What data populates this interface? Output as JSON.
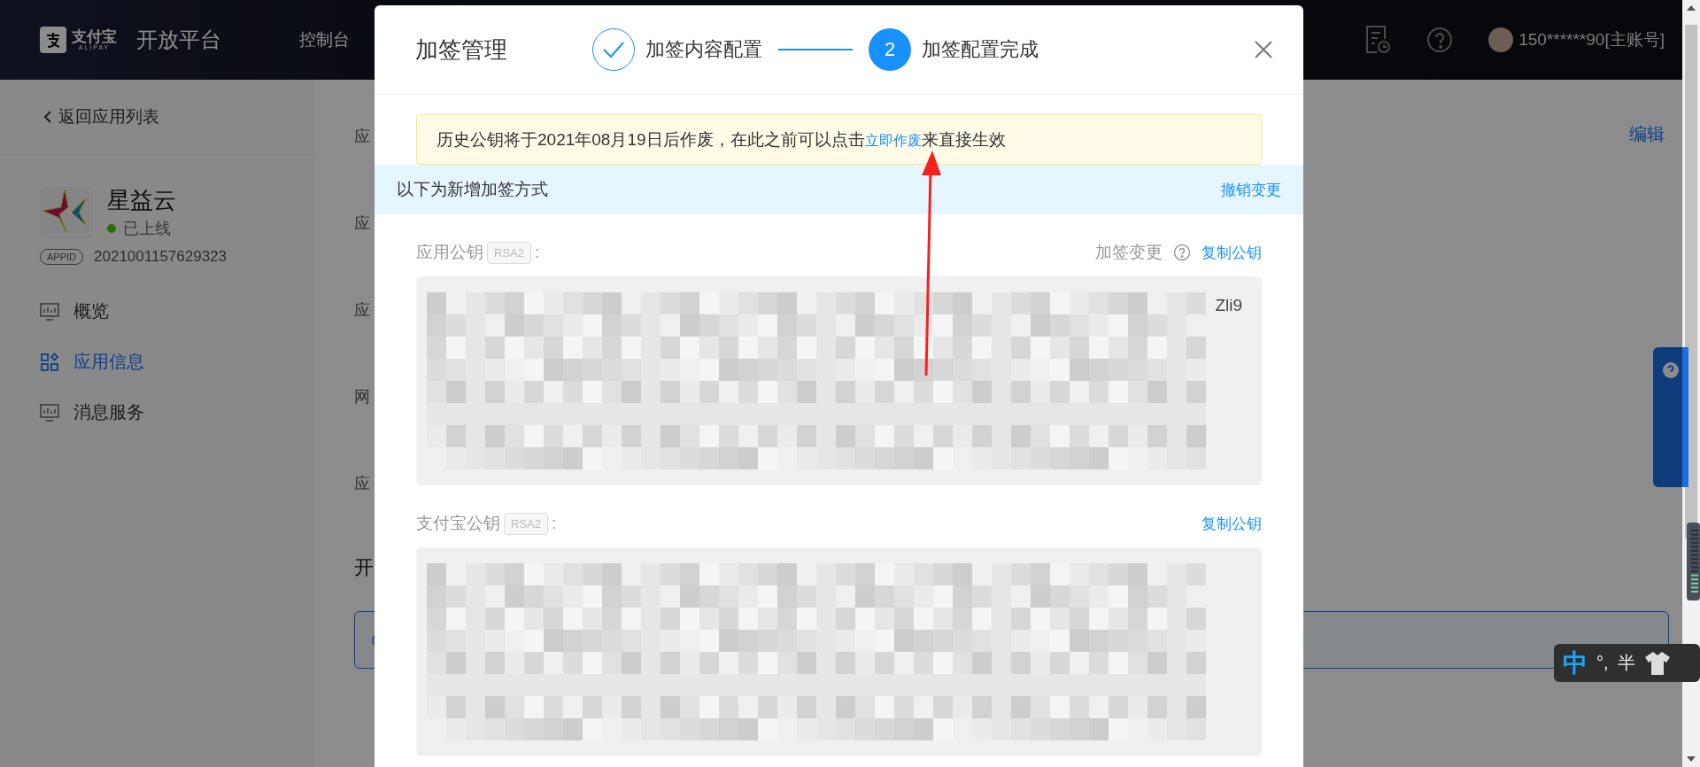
{
  "header": {
    "brand_mark": "支付宝",
    "brand_sub": "ALIPAY",
    "title": "开放平台",
    "nav": [
      {
        "label": "控制台"
      }
    ],
    "account": "150******90[主账号]"
  },
  "sidebar": {
    "back": "返回应用列表",
    "app_name": "星益云",
    "status": "已上线",
    "appid_tag": "APPID",
    "appid": "2021001157629323",
    "menu": [
      {
        "label": "概览",
        "kind": "chart",
        "selected": false
      },
      {
        "label": "应用信息",
        "kind": "grid",
        "selected": true
      },
      {
        "label": "消息服务",
        "kind": "chart",
        "selected": false
      }
    ]
  },
  "main": {
    "row_labels": [
      "应",
      "应",
      "应",
      "网",
      "应"
    ],
    "section_title": "开",
    "edit": "编辑"
  },
  "modal": {
    "title": "加签管理",
    "steps": [
      {
        "label": "加签内容配置",
        "done": true
      },
      {
        "label": "加签配置完成",
        "done": false,
        "number": "2"
      }
    ],
    "notice": {
      "before": "历史公钥将于2021年08月19日后作废，在此之前可以点击",
      "link": "立即作废",
      "after": "来直接生效"
    },
    "banner": {
      "text": "以下为新增加签方式",
      "action": "撤销变更"
    },
    "keys": [
      {
        "label": "应用公钥",
        "tag": "RSA2",
        "colon": ":",
        "change": "加签变更",
        "copy": "复制公钥",
        "visible_tail": "Zli9"
      },
      {
        "label": "支付宝公钥",
        "tag": "RSA2",
        "colon": ":",
        "copy": "复制公钥"
      }
    ]
  },
  "ime": {
    "mode": "中",
    "punct": "°,",
    "width": "半"
  }
}
